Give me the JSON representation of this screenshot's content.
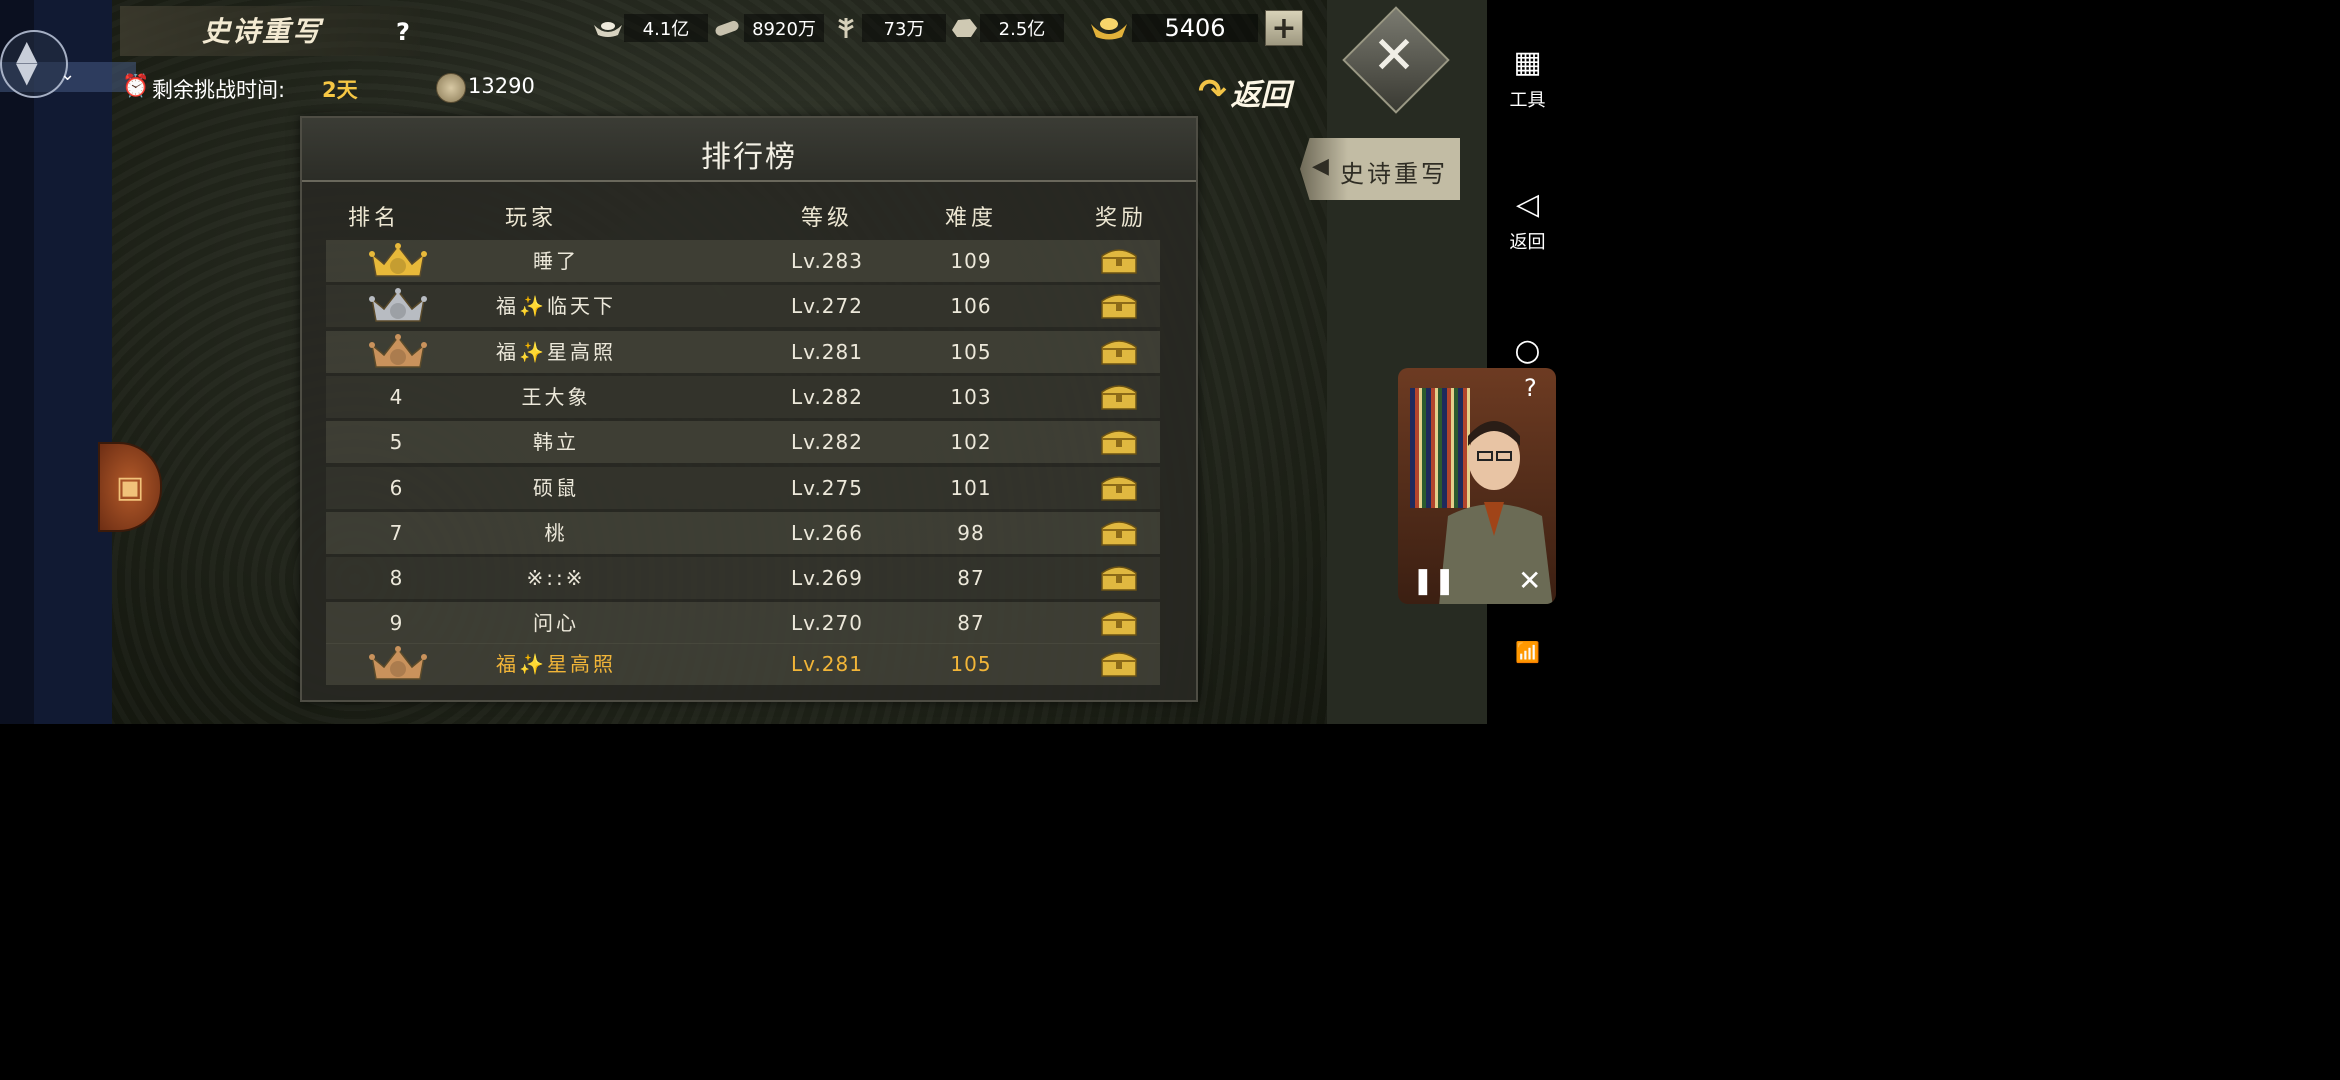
{
  "header": {
    "title": "史诗重写",
    "help": "?",
    "resources": [
      {
        "icon": "silver-ingot-icon",
        "value": "4.1亿"
      },
      {
        "icon": "wood-log-icon",
        "value": "8920万"
      },
      {
        "icon": "grain-icon",
        "value": "73万"
      },
      {
        "icon": "stone-icon",
        "value": "2.5亿"
      }
    ],
    "gold": {
      "icon": "gold-ingot-icon",
      "value": "5406"
    },
    "plus": "+",
    "close": "✕"
  },
  "timer": {
    "label": "剩余挑战时间:",
    "value": "2天"
  },
  "currency": {
    "icon": "coin-icon",
    "value": "13290"
  },
  "return_button": {
    "label": "返回"
  },
  "side_tab": {
    "label": "史诗重写"
  },
  "panel": {
    "title": "排行榜",
    "columns": [
      "排名",
      "玩家",
      "等级",
      "难度",
      "奖励"
    ]
  },
  "rows": [
    {
      "rank": "1",
      "crown": "gold",
      "player": "睡了",
      "level": "Lv.283",
      "difficulty": "109"
    },
    {
      "rank": "2",
      "crown": "silver",
      "player": "福✨临天下",
      "level": "Lv.272",
      "difficulty": "106"
    },
    {
      "rank": "3",
      "crown": "bronze",
      "player": "福✨星高照",
      "level": "Lv.281",
      "difficulty": "105"
    },
    {
      "rank": "4",
      "crown": "",
      "player": "王大象",
      "level": "Lv.282",
      "difficulty": "103"
    },
    {
      "rank": "5",
      "crown": "",
      "player": "韩立",
      "level": "Lv.282",
      "difficulty": "102"
    },
    {
      "rank": "6",
      "crown": "",
      "player": "硕鼠",
      "level": "Lv.275",
      "difficulty": "101"
    },
    {
      "rank": "7",
      "crown": "",
      "player": "桃",
      "level": "Lv.266",
      "difficulty": "98"
    },
    {
      "rank": "8",
      "crown": "",
      "player": "※::※",
      "level": "Lv.269",
      "difficulty": "87"
    },
    {
      "rank": "9",
      "crown": "",
      "player": "问心",
      "level": "Lv.270",
      "difficulty": "87"
    }
  ],
  "self_row": {
    "rank": "3",
    "crown": "bronze",
    "player": "福✨星高照",
    "level": "Lv.281",
    "difficulty": "105"
  },
  "nav": {
    "tools": "工具",
    "back": "返回"
  },
  "video": {
    "pause": "❚❚",
    "close": "✕",
    "help": "?"
  },
  "colors": {
    "accent_gold": "#f6c744",
    "self_row_text": "#f2b538",
    "crown_gold": "#e8b93a",
    "crown_silver": "#b8bcc2",
    "crown_bronze": "#c9925c"
  }
}
